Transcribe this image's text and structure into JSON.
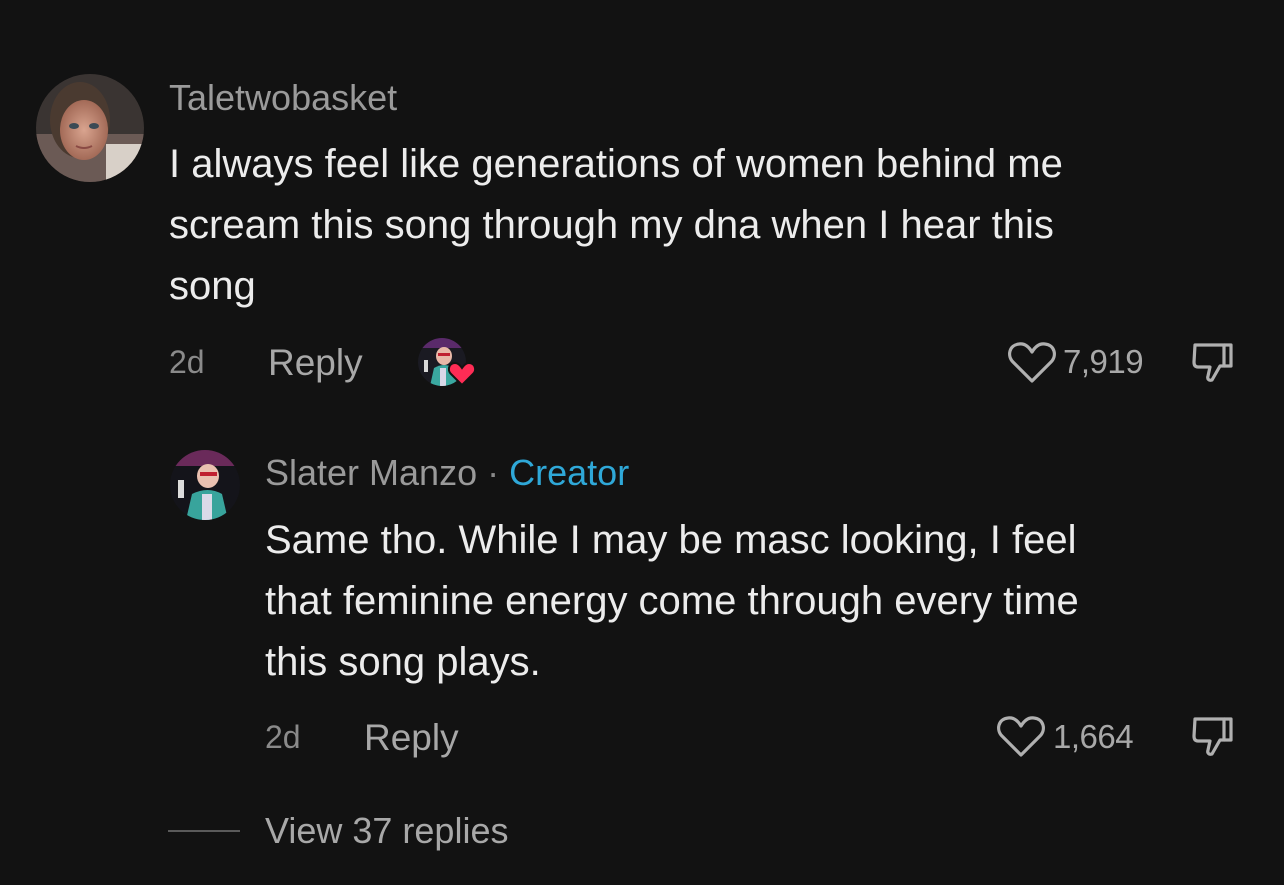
{
  "comments": [
    {
      "username": "Taletwobasket",
      "text_lines": [
        "I always feel like generations of women behind me",
        "scream this song through my dna when I hear this",
        "song"
      ],
      "time": "2d",
      "reply_label": "Reply",
      "likes": "7,919"
    }
  ],
  "reply": {
    "username": "Slater Manzo",
    "separator": "·",
    "badge": "Creator",
    "text_lines": [
      "Same tho. While I may be masc looking, I feel",
      "that feminine energy come through every time",
      "this song plays."
    ],
    "time": "2d",
    "reply_label": "Reply",
    "likes": "1,664"
  },
  "view_replies": "View 37 replies",
  "colors": {
    "background": "#121212",
    "creator_accent": "#2fa8d8",
    "creator_liked_heart": "#fe2c55"
  },
  "icons": {
    "like": "heart-outline-icon",
    "dislike": "thumbs-down-icon",
    "creator_liked": "creator-liked-badge"
  }
}
